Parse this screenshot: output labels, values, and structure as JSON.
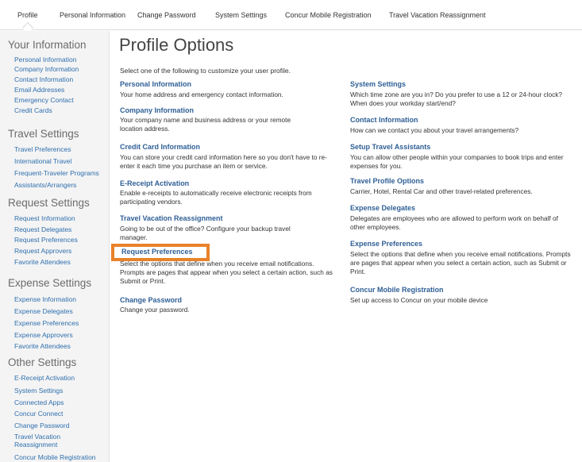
{
  "topnav": {
    "tabs": [
      "Profile",
      "Personal Information",
      "Change Password",
      "System Settings",
      "Concur Mobile Registration",
      "Travel Vacation Reassignment"
    ]
  },
  "sidebar": {
    "sections": [
      {
        "heading": "Your Information",
        "items": [
          "Personal Information",
          "Company Information",
          "Contact Information",
          "Email Addresses",
          "Emergency Contact",
          "Credit Cards"
        ]
      },
      {
        "heading": "Travel Settings",
        "items": [
          "Travel Preferences",
          "International Travel",
          "Frequent-Traveler Programs",
          "Assistants/Arrangers"
        ]
      },
      {
        "heading": "Request Settings",
        "items": [
          "Request Information",
          "Request Delegates",
          "Request Preferences",
          "Request Approvers",
          "Favorite Attendees"
        ]
      },
      {
        "heading": "Expense Settings",
        "items": [
          "Expense Information",
          "Expense Delegates",
          "Expense Preferences",
          "Expense Approvers",
          "Favorite Attendees"
        ]
      },
      {
        "heading": "Other Settings",
        "items": [
          "E-Receipt Activation",
          "System Settings",
          "Connected Apps",
          "Concur Connect",
          "Change Password",
          "Travel Vacation Reassignment",
          "Concur Mobile Registration"
        ]
      }
    ]
  },
  "main": {
    "title": "Profile Options",
    "intro": "Select one of the following to customize your user profile.",
    "left": [
      {
        "title": "Personal Information",
        "desc": "Your home address and emergency contact information."
      },
      {
        "title": "Company Information",
        "desc": "Your company name and business address or your remote location address."
      },
      {
        "title": "Credit Card Information",
        "desc": "You can store your credit card information here so you don't have to re-enter it each time you purchase an item or service."
      },
      {
        "title": "E-Receipt Activation",
        "desc": "Enable e-receipts to automatically receive electronic receipts from participating vendors."
      },
      {
        "title": "Travel Vacation Reassignment",
        "desc": "Going to be out of the office? Configure your backup travel manager."
      },
      {
        "title": "Request Preferences",
        "desc": "Select the options that define when you receive email notifications. Prompts are pages that appear when you select a certain action, such as Submit or Print."
      },
      {
        "title": "Change Password",
        "desc": "Change your password."
      }
    ],
    "right": [
      {
        "title": "System Settings",
        "desc": "Which time zone are you in? Do you prefer to use a 12 or 24-hour clock? When does your workday start/end?"
      },
      {
        "title": "Contact Information",
        "desc": "How can we contact you about your travel arrangements?"
      },
      {
        "title": "Setup Travel Assistants",
        "desc": "You can allow other people within your companies to book trips and enter expenses for you."
      },
      {
        "title": "Travel Profile Options",
        "desc": "Carrier, Hotel, Rental Car and other travel-related preferences."
      },
      {
        "title": "Expense Delegates",
        "desc": "Delegates are employees who are allowed to perform work on behalf of other employees."
      },
      {
        "title": "Expense Preferences",
        "desc": "Select the options that define when you receive email notifications. Prompts are pages that appear when you select a certain action, such as Submit or Print."
      },
      {
        "title": "Concur Mobile Registration",
        "desc": "Set up access to Concur on your mobile device"
      }
    ]
  },
  "highlight_color": "#e8822a",
  "link_color": "#2f5f95"
}
